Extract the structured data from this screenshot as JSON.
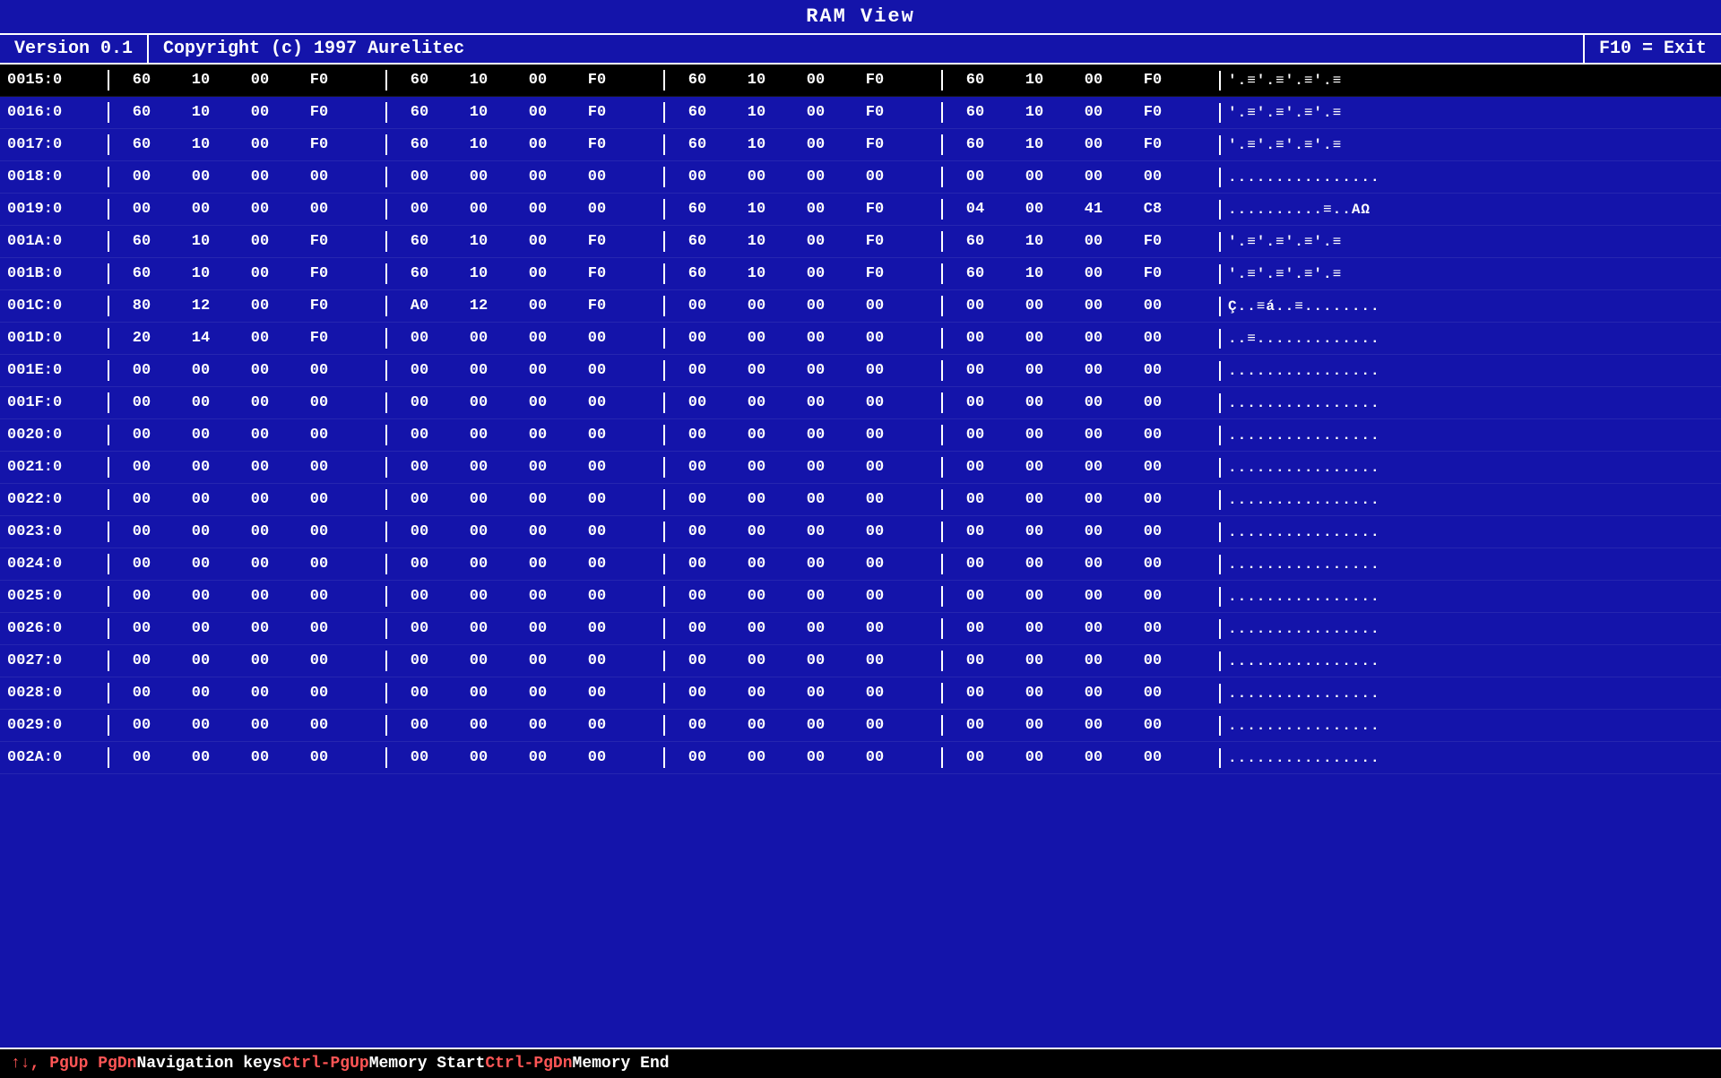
{
  "title": "RAM View",
  "header": {
    "version": "Version 0.1",
    "copyright": "Copyright (c) 1997 Aurelitec",
    "exit": "F10 = Exit"
  },
  "rows": [
    {
      "addr": "0015:0",
      "col1": [
        "60",
        "10",
        "00",
        "F0"
      ],
      "col2": [
        "60",
        "10",
        "00",
        "F0"
      ],
      "col3": [
        "60",
        "10",
        "00",
        "F0"
      ],
      "col4": [
        "60",
        "10",
        "00",
        "F0"
      ],
      "ascii": "'.≡'.≡'.≡'.≡",
      "highlight": true
    },
    {
      "addr": "0016:0",
      "col1": [
        "60",
        "10",
        "00",
        "F0"
      ],
      "col2": [
        "60",
        "10",
        "00",
        "F0"
      ],
      "col3": [
        "60",
        "10",
        "00",
        "F0"
      ],
      "col4": [
        "60",
        "10",
        "00",
        "F0"
      ],
      "ascii": "'.≡'.≡'.≡'.≡"
    },
    {
      "addr": "0017:0",
      "col1": [
        "60",
        "10",
        "00",
        "F0"
      ],
      "col2": [
        "60",
        "10",
        "00",
        "F0"
      ],
      "col3": [
        "60",
        "10",
        "00",
        "F0"
      ],
      "col4": [
        "60",
        "10",
        "00",
        "F0"
      ],
      "ascii": "'.≡'.≡'.≡'.≡"
    },
    {
      "addr": "0018:0",
      "col1": [
        "00",
        "00",
        "00",
        "00"
      ],
      "col2": [
        "00",
        "00",
        "00",
        "00"
      ],
      "col3": [
        "00",
        "00",
        "00",
        "00"
      ],
      "col4": [
        "00",
        "00",
        "00",
        "00"
      ],
      "ascii": "................"
    },
    {
      "addr": "0019:0",
      "col1": [
        "00",
        "00",
        "00",
        "00"
      ],
      "col2": [
        "00",
        "00",
        "00",
        "00"
      ],
      "col3": [
        "60",
        "10",
        "00",
        "F0"
      ],
      "col4": [
        "04",
        "00",
        "41",
        "C8"
      ],
      "ascii": "..........≡..AΩ"
    },
    {
      "addr": "001A:0",
      "col1": [
        "60",
        "10",
        "00",
        "F0"
      ],
      "col2": [
        "60",
        "10",
        "00",
        "F0"
      ],
      "col3": [
        "60",
        "10",
        "00",
        "F0"
      ],
      "col4": [
        "60",
        "10",
        "00",
        "F0"
      ],
      "ascii": "'.≡'.≡'.≡'.≡"
    },
    {
      "addr": "001B:0",
      "col1": [
        "60",
        "10",
        "00",
        "F0"
      ],
      "col2": [
        "60",
        "10",
        "00",
        "F0"
      ],
      "col3": [
        "60",
        "10",
        "00",
        "F0"
      ],
      "col4": [
        "60",
        "10",
        "00",
        "F0"
      ],
      "ascii": "'.≡'.≡'.≡'.≡"
    },
    {
      "addr": "001C:0",
      "col1": [
        "80",
        "12",
        "00",
        "F0"
      ],
      "col2": [
        "A0",
        "12",
        "00",
        "F0"
      ],
      "col3": [
        "00",
        "00",
        "00",
        "00"
      ],
      "col4": [
        "00",
        "00",
        "00",
        "00"
      ],
      "ascii": "Ç..≡á..≡........"
    },
    {
      "addr": "001D:0",
      "col1": [
        "20",
        "14",
        "00",
        "F0"
      ],
      "col2": [
        "00",
        "00",
        "00",
        "00"
      ],
      "col3": [
        "00",
        "00",
        "00",
        "00"
      ],
      "col4": [
        "00",
        "00",
        "00",
        "00"
      ],
      "ascii": "..≡............."
    },
    {
      "addr": "001E:0",
      "col1": [
        "00",
        "00",
        "00",
        "00"
      ],
      "col2": [
        "00",
        "00",
        "00",
        "00"
      ],
      "col3": [
        "00",
        "00",
        "00",
        "00"
      ],
      "col4": [
        "00",
        "00",
        "00",
        "00"
      ],
      "ascii": "................"
    },
    {
      "addr": "001F:0",
      "col1": [
        "00",
        "00",
        "00",
        "00"
      ],
      "col2": [
        "00",
        "00",
        "00",
        "00"
      ],
      "col3": [
        "00",
        "00",
        "00",
        "00"
      ],
      "col4": [
        "00",
        "00",
        "00",
        "00"
      ],
      "ascii": "................"
    },
    {
      "addr": "0020:0",
      "col1": [
        "00",
        "00",
        "00",
        "00"
      ],
      "col2": [
        "00",
        "00",
        "00",
        "00"
      ],
      "col3": [
        "00",
        "00",
        "00",
        "00"
      ],
      "col4": [
        "00",
        "00",
        "00",
        "00"
      ],
      "ascii": "................"
    },
    {
      "addr": "0021:0",
      "col1": [
        "00",
        "00",
        "00",
        "00"
      ],
      "col2": [
        "00",
        "00",
        "00",
        "00"
      ],
      "col3": [
        "00",
        "00",
        "00",
        "00"
      ],
      "col4": [
        "00",
        "00",
        "00",
        "00"
      ],
      "ascii": "................"
    },
    {
      "addr": "0022:0",
      "col1": [
        "00",
        "00",
        "00",
        "00"
      ],
      "col2": [
        "00",
        "00",
        "00",
        "00"
      ],
      "col3": [
        "00",
        "00",
        "00",
        "00"
      ],
      "col4": [
        "00",
        "00",
        "00",
        "00"
      ],
      "ascii": "................"
    },
    {
      "addr": "0023:0",
      "col1": [
        "00",
        "00",
        "00",
        "00"
      ],
      "col2": [
        "00",
        "00",
        "00",
        "00"
      ],
      "col3": [
        "00",
        "00",
        "00",
        "00"
      ],
      "col4": [
        "00",
        "00",
        "00",
        "00"
      ],
      "ascii": "................"
    },
    {
      "addr": "0024:0",
      "col1": [
        "00",
        "00",
        "00",
        "00"
      ],
      "col2": [
        "00",
        "00",
        "00",
        "00"
      ],
      "col3": [
        "00",
        "00",
        "00",
        "00"
      ],
      "col4": [
        "00",
        "00",
        "00",
        "00"
      ],
      "ascii": "................"
    },
    {
      "addr": "0025:0",
      "col1": [
        "00",
        "00",
        "00",
        "00"
      ],
      "col2": [
        "00",
        "00",
        "00",
        "00"
      ],
      "col3": [
        "00",
        "00",
        "00",
        "00"
      ],
      "col4": [
        "00",
        "00",
        "00",
        "00"
      ],
      "ascii": "................"
    },
    {
      "addr": "0026:0",
      "col1": [
        "00",
        "00",
        "00",
        "00"
      ],
      "col2": [
        "00",
        "00",
        "00",
        "00"
      ],
      "col3": [
        "00",
        "00",
        "00",
        "00"
      ],
      "col4": [
        "00",
        "00",
        "00",
        "00"
      ],
      "ascii": "................"
    },
    {
      "addr": "0027:0",
      "col1": [
        "00",
        "00",
        "00",
        "00"
      ],
      "col2": [
        "00",
        "00",
        "00",
        "00"
      ],
      "col3": [
        "00",
        "00",
        "00",
        "00"
      ],
      "col4": [
        "00",
        "00",
        "00",
        "00"
      ],
      "ascii": "................"
    },
    {
      "addr": "0028:0",
      "col1": [
        "00",
        "00",
        "00",
        "00"
      ],
      "col2": [
        "00",
        "00",
        "00",
        "00"
      ],
      "col3": [
        "00",
        "00",
        "00",
        "00"
      ],
      "col4": [
        "00",
        "00",
        "00",
        "00"
      ],
      "ascii": "................"
    },
    {
      "addr": "0029:0",
      "col1": [
        "00",
        "00",
        "00",
        "00"
      ],
      "col2": [
        "00",
        "00",
        "00",
        "00"
      ],
      "col3": [
        "00",
        "00",
        "00",
        "00"
      ],
      "col4": [
        "00",
        "00",
        "00",
        "00"
      ],
      "ascii": "................"
    },
    {
      "addr": "002A:0",
      "col1": [
        "00",
        "00",
        "00",
        "00"
      ],
      "col2": [
        "00",
        "00",
        "00",
        "00"
      ],
      "col3": [
        "00",
        "00",
        "00",
        "00"
      ],
      "col4": [
        "00",
        "00",
        "00",
        "00"
      ],
      "ascii": "................"
    }
  ],
  "statusBar": {
    "part1_key": "↑↓, PgUp PgDn",
    "part1_text": " Navigation keys",
    "part2_key": "  Ctrl-PgUp",
    "part2_text": " Memory Start",
    "part3_key": "  Ctrl-PgDn",
    "part3_text": " Memory End"
  }
}
